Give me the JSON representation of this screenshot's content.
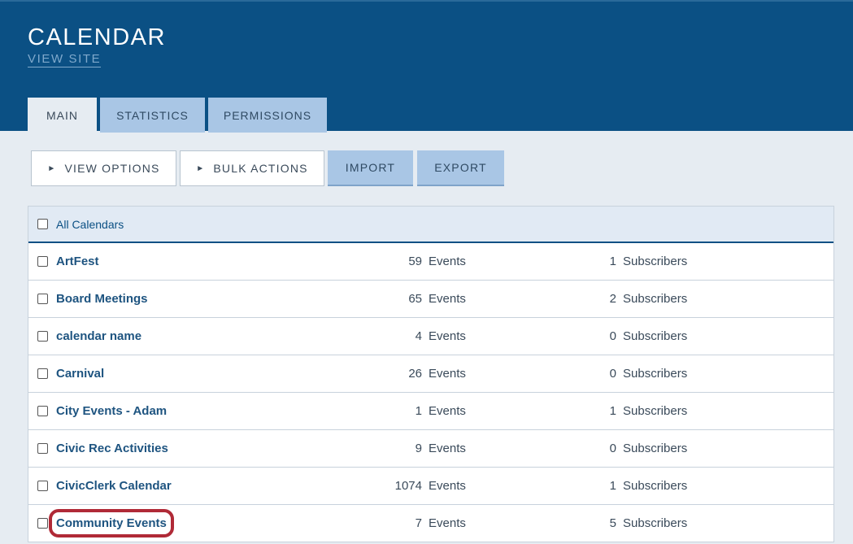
{
  "header": {
    "title": "CALENDAR",
    "view_site": "VIEW SITE"
  },
  "tabs": [
    {
      "label": "MAIN",
      "active": true
    },
    {
      "label": "STATISTICS",
      "active": false
    },
    {
      "label": "PERMISSIONS",
      "active": false
    }
  ],
  "toolbar": {
    "view_options": "VIEW OPTIONS",
    "bulk_actions": "BULK ACTIONS",
    "import": "IMPORT",
    "export": "EXPORT",
    "expand_glyph": "►"
  },
  "table": {
    "header_label": "All Calendars",
    "events_label": "Events",
    "subscribers_label": "Subscribers",
    "rows": [
      {
        "name": "ArtFest",
        "events": "59",
        "subscribers": "1"
      },
      {
        "name": "Board Meetings",
        "events": "65",
        "subscribers": "2"
      },
      {
        "name": "calendar name",
        "events": "4",
        "subscribers": "0"
      },
      {
        "name": "Carnival",
        "events": "26",
        "subscribers": "0"
      },
      {
        "name": "City Events - Adam",
        "events": "1",
        "subscribers": "1"
      },
      {
        "name": "Civic Rec Activities",
        "events": "9",
        "subscribers": "0"
      },
      {
        "name": "CivicClerk Calendar",
        "events": "1074",
        "subscribers": "1"
      },
      {
        "name": "Community Events",
        "events": "7",
        "subscribers": "5"
      }
    ]
  },
  "colors": {
    "header_bg": "#0b5084",
    "tab_bg": "#a9c6e5",
    "highlight": "#b02a37"
  }
}
